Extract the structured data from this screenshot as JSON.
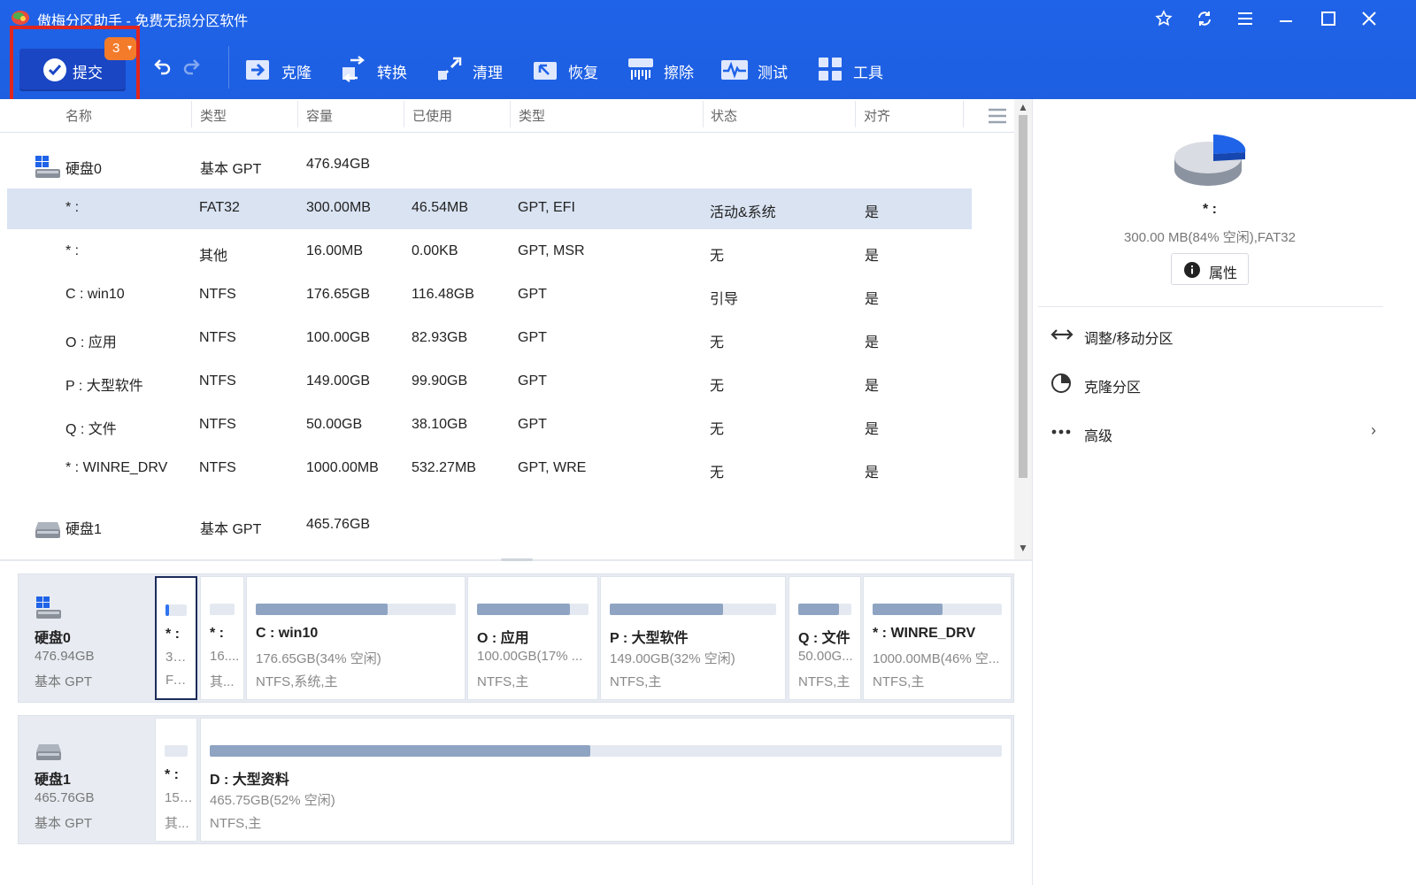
{
  "app": {
    "title": "傲梅分区助手 - 免费无损分区软件"
  },
  "toolbar": {
    "submit_label": "提交",
    "pending_count": "3",
    "tools": [
      {
        "label": "克隆",
        "icon": "clone-icon"
      },
      {
        "label": "转换",
        "icon": "convert-icon"
      },
      {
        "label": "清理",
        "icon": "cleanup-icon"
      },
      {
        "label": "恢复",
        "icon": "recover-icon"
      },
      {
        "label": "擦除",
        "icon": "wipe-icon"
      },
      {
        "label": "测试",
        "icon": "test-icon"
      },
      {
        "label": "工具",
        "icon": "tools-icon"
      }
    ]
  },
  "table": {
    "headers": [
      "名称",
      "类型",
      "容量",
      "已使用",
      "类型",
      "状态",
      "对齐"
    ],
    "disks": [
      {
        "name": "硬盘0",
        "type": "基本 GPT",
        "capacity": "476.94GB"
      },
      {
        "name": "硬盘1",
        "type": "基本 GPT",
        "capacity": "465.76GB"
      }
    ],
    "rows": [
      {
        "name": "* :",
        "fs": "FAT32",
        "capacity": "300.00MB",
        "used": "46.54MB",
        "type": "GPT, EFI",
        "status": "活动&系统",
        "align": "是"
      },
      {
        "name": "* :",
        "fs": "其他",
        "capacity": "16.00MB",
        "used": "0.00KB",
        "type": "GPT, MSR",
        "status": "无",
        "align": "是"
      },
      {
        "name": "C : win10",
        "fs": "NTFS",
        "capacity": "176.65GB",
        "used": "116.48GB",
        "type": "GPT",
        "status": "引导",
        "align": "是"
      },
      {
        "name": "O : 应用",
        "fs": "NTFS",
        "capacity": "100.00GB",
        "used": "82.93GB",
        "type": "GPT",
        "status": "无",
        "align": "是"
      },
      {
        "name": "P : 大型软件",
        "fs": "NTFS",
        "capacity": "149.00GB",
        "used": "99.90GB",
        "type": "GPT",
        "status": "无",
        "align": "是"
      },
      {
        "name": "Q : 文件",
        "fs": "NTFS",
        "capacity": "50.00GB",
        "used": "38.10GB",
        "type": "GPT",
        "status": "无",
        "align": "是"
      },
      {
        "name": "* : WINRE_DRV",
        "fs": "NTFS",
        "capacity": "1000.00MB",
        "used": "532.27MB",
        "type": "GPT, WRE",
        "status": "无",
        "align": "是"
      }
    ]
  },
  "diskmap": {
    "disk0": {
      "name": "硬盘0",
      "size": "476.94GB",
      "type": "基本 GPT",
      "parts": [
        {
          "name": "* :",
          "size": "300...",
          "type": "FA...",
          "used": 0.16
        },
        {
          "name": "* :",
          "size": "16....",
          "type": "其...",
          "used": 0.0
        },
        {
          "name": "C : win10",
          "size": "176.65GB(34% 空闲)",
          "type": "NTFS,系统,主",
          "used": 0.66
        },
        {
          "name": "O : 应用",
          "size": "100.00GB(17% ...",
          "type": "NTFS,主",
          "used": 0.83
        },
        {
          "name": "P : 大型软件",
          "size": "149.00GB(32% 空闲)",
          "type": "NTFS,主",
          "used": 0.68
        },
        {
          "name": "Q : 文件",
          "size": "50.00G...",
          "type": "NTFS,主",
          "used": 0.76
        },
        {
          "name": "* : WINRE_DRV",
          "size": "1000.00MB(46% 空...",
          "type": "NTFS,主",
          "used": 0.54
        }
      ]
    },
    "disk1": {
      "name": "硬盘1",
      "size": "465.76GB",
      "type": "基本 GPT",
      "parts": [
        {
          "name": "* :",
          "size": "15....",
          "type": "其...",
          "used": 0.0
        },
        {
          "name": "D : 大型资料",
          "size": "465.75GB(52% 空闲)",
          "type": "NTFS,主",
          "used": 0.48
        }
      ]
    }
  },
  "sidepanel": {
    "name": "* :",
    "info": "300.00 MB(84% 空闲),FAT32",
    "properties_label": "属性",
    "actions": [
      {
        "label": "调整/移动分区",
        "icon": "resize-move-icon"
      },
      {
        "label": "克隆分区",
        "icon": "clone-partition-icon"
      },
      {
        "label": "高级",
        "icon": "more-icon"
      }
    ]
  },
  "colors": {
    "toolbar": "#1f63e8",
    "selected_row": "#d9e3f2",
    "badge": "#f37b2a",
    "highlight": "#e0261d"
  }
}
